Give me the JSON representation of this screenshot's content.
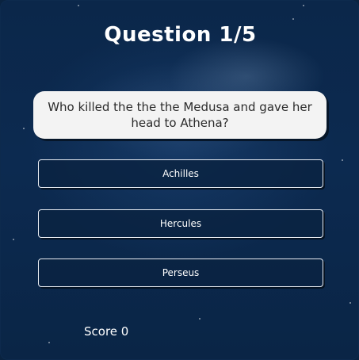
{
  "quiz": {
    "title": "Question 1/5",
    "question": "Who killed the the the Medusa and gave her head to Athena?",
    "answers": [
      {
        "label": "Achilles"
      },
      {
        "label": "Hercules"
      },
      {
        "label": "Perseus"
      }
    ],
    "score_label": "Score 0"
  },
  "colors": {
    "background": "#0b274a",
    "question_box": "#f3f3f3",
    "text_primary": "#ffffff",
    "question_text": "#2b2b2b"
  }
}
